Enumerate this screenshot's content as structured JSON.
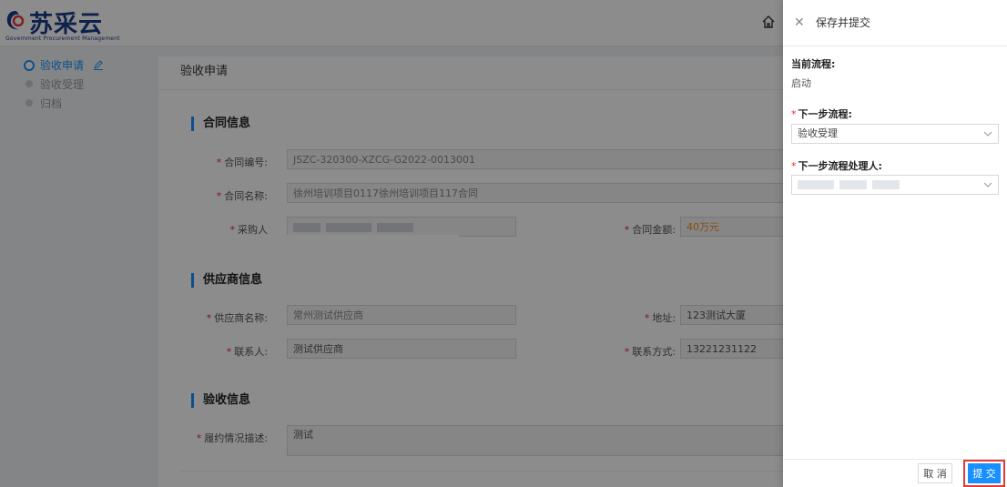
{
  "app": {
    "logo_text": "苏采云",
    "logo_sub": "Government Procurement Management",
    "colors": {
      "primary": "#1890ff",
      "required": "#f5222d",
      "amount": "#fa8c16",
      "highlight": "#e53935",
      "logo": "#1b3b8a"
    }
  },
  "steps": [
    {
      "label": "验收申请",
      "state": "active"
    },
    {
      "label": "验收受理",
      "state": "pending"
    },
    {
      "label": "归档",
      "state": "pending"
    }
  ],
  "main": {
    "title": "验收申请",
    "sections": {
      "contract": "合同信息",
      "supplier": "供应商信息",
      "acceptance": "验收信息"
    },
    "fields": {
      "contract_no": {
        "label": "合同编号:",
        "value": "JSZC-320300-XZCG-G2022-0013001"
      },
      "contract_name": {
        "label": "合同名称:",
        "value": "徐州培训项目0117徐州培训项目117合同"
      },
      "purchaser": {
        "label": "采购人"
      },
      "contract_amount": {
        "label": "合同金额:",
        "value": "40万元"
      },
      "supplier_name": {
        "label": "供应商名称:",
        "value": "常州测试供应商"
      },
      "address": {
        "label": "地址:",
        "value": "123测试大厦"
      },
      "contact": {
        "label": "联系人:",
        "value": "测试供应商"
      },
      "phone": {
        "label": "联系方式:",
        "value": "13221231122"
      },
      "performance": {
        "label": "履约情况描述:",
        "value": "测试"
      }
    }
  },
  "drawer": {
    "title": "保存并提交",
    "current_label": "当前流程:",
    "current_value": "启动",
    "next_label": "下一步流程:",
    "next_value": "验收受理",
    "handler_label": "下一步流程处理人:",
    "cancel": "取 消",
    "submit": "提 交"
  }
}
